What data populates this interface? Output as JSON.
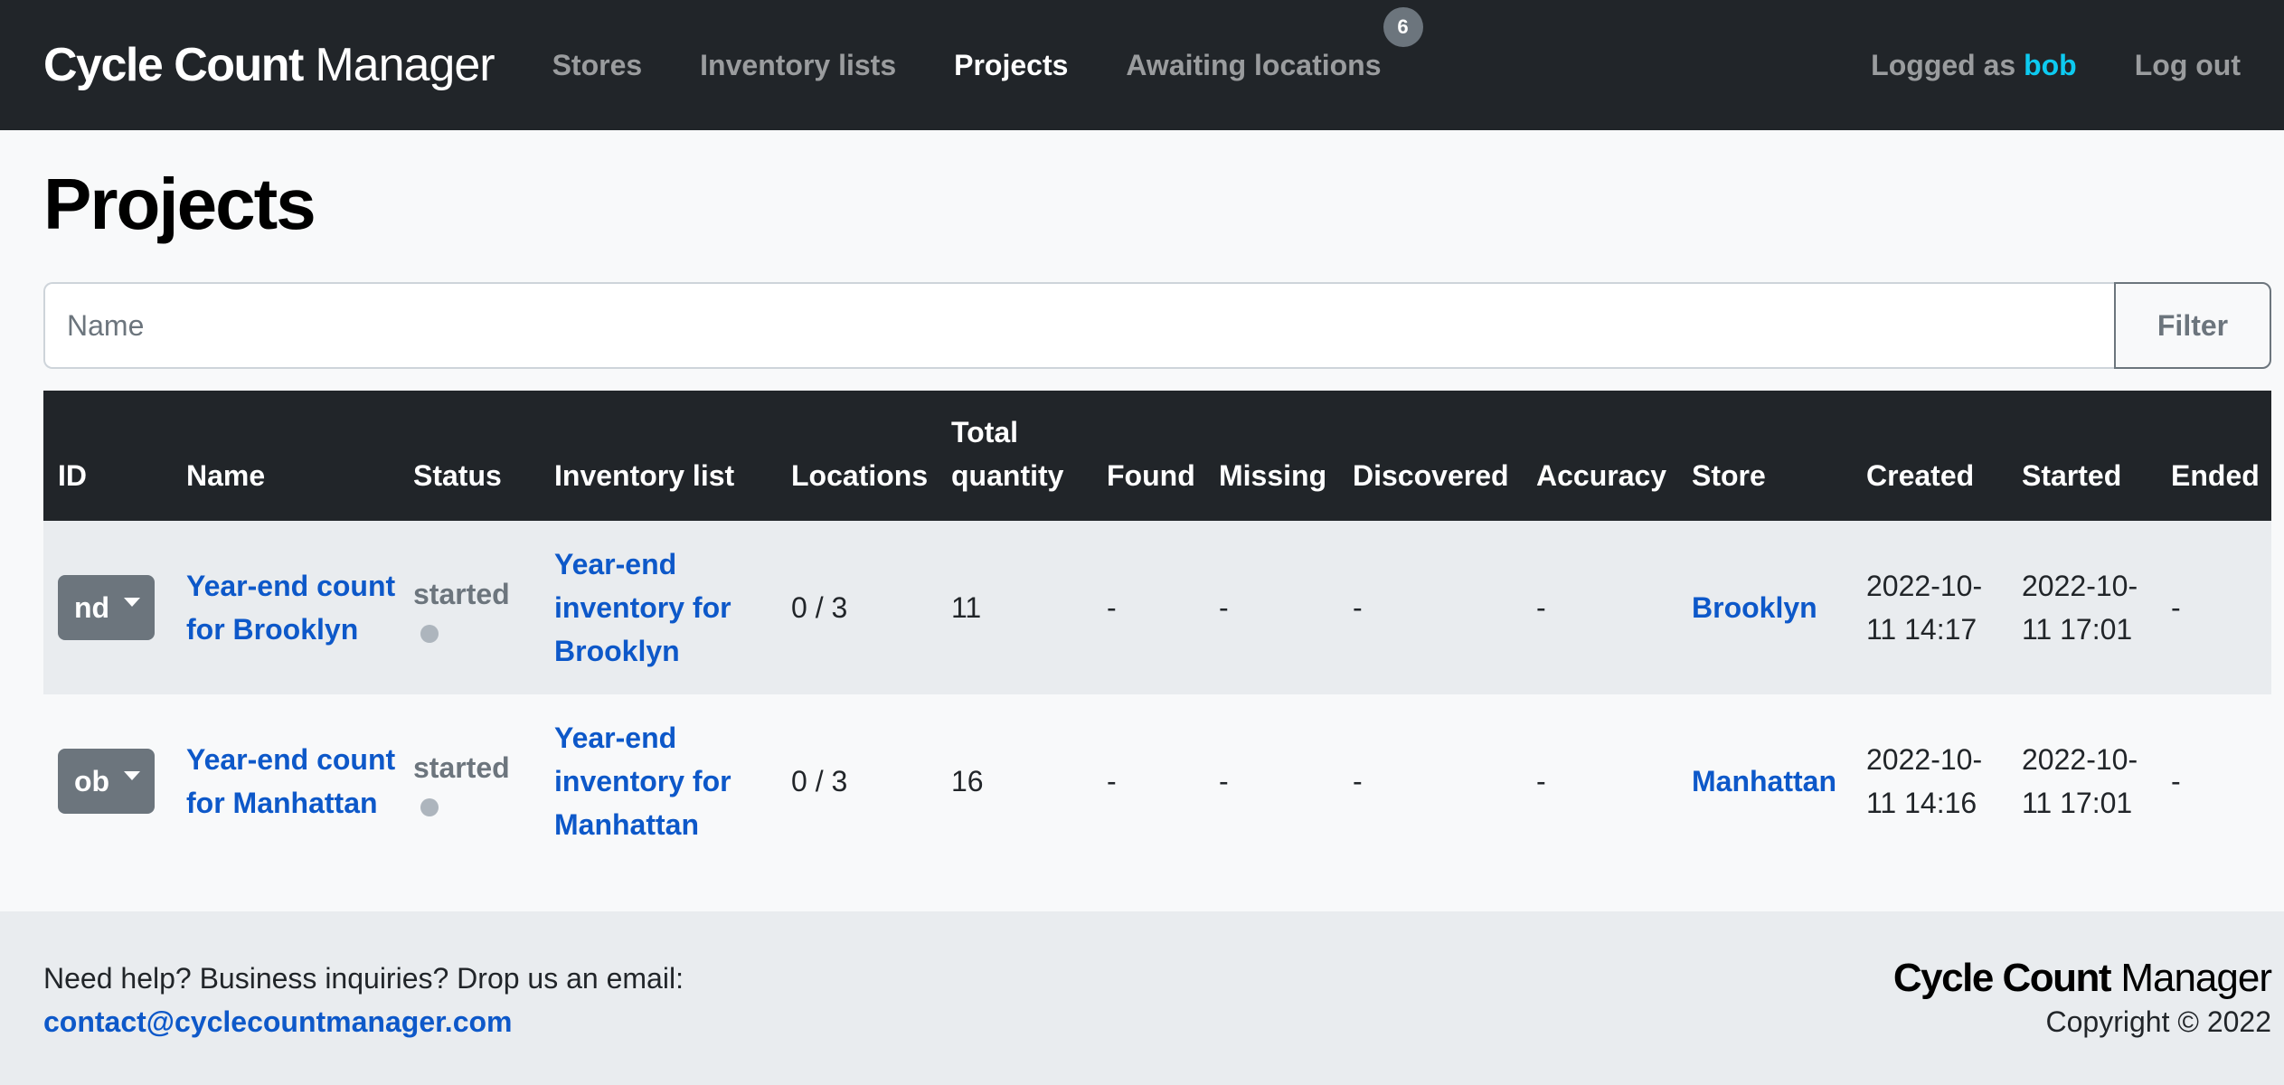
{
  "navbar": {
    "brand_bold": "Cycle Count",
    "brand_light": "Manager",
    "items": [
      {
        "label": "Stores"
      },
      {
        "label": "Inventory lists"
      },
      {
        "label": "Projects"
      },
      {
        "label": "Awaiting locations",
        "badge": "6"
      }
    ],
    "logged_as_prefix": "Logged as",
    "username": "bob",
    "logout_label": "Log out"
  },
  "page": {
    "title": "Projects"
  },
  "filter": {
    "placeholder": "Name",
    "value": "",
    "button_label": "Filter"
  },
  "table": {
    "headers": {
      "id": "ID",
      "name": "Name",
      "status": "Status",
      "inventory_list": "Inventory list",
      "locations": "Locations",
      "total_quantity_line1": "Total",
      "total_quantity_line2": "quantity",
      "found": "Found",
      "missing": "Missing",
      "discovered": "Discovered",
      "accuracy": "Accuracy",
      "store": "Store",
      "created": "Created",
      "started": "Started",
      "ended": "Ended"
    },
    "rows": [
      {
        "id": "nd",
        "name": "Year-end count for Brooklyn",
        "status": "started",
        "inventory_list": "Year-end inventory for Brooklyn",
        "locations": "0 / 3",
        "total_quantity": "11",
        "found": "-",
        "missing": "-",
        "discovered": "-",
        "accuracy": "-",
        "store": "Brooklyn",
        "created": "2022-10-11 14:17",
        "started": "2022-10-11 17:01",
        "ended": "-"
      },
      {
        "id": "ob",
        "name": "Year-end count for Manhattan",
        "status": "started",
        "inventory_list": "Year-end inventory for Manhattan",
        "locations": "0 / 3",
        "total_quantity": "16",
        "found": "-",
        "missing": "-",
        "discovered": "-",
        "accuracy": "-",
        "store": "Manhattan",
        "created": "2022-10-11 14:16",
        "started": "2022-10-11 17:01",
        "ended": "-"
      }
    ]
  },
  "footer": {
    "help_text": "Need help? Business inquiries? Drop us an email:",
    "email": "contact@cyclecountmanager.com",
    "brand_bold": "Cycle Count",
    "brand_light": "Manager",
    "copyright": "Copyright © 2022"
  },
  "colors": {
    "navbar_bg": "#212529",
    "link": "#0d58c9",
    "username": "#0dcaf0",
    "secondary": "#6c757d",
    "row_stripe": "#e9ecef"
  }
}
